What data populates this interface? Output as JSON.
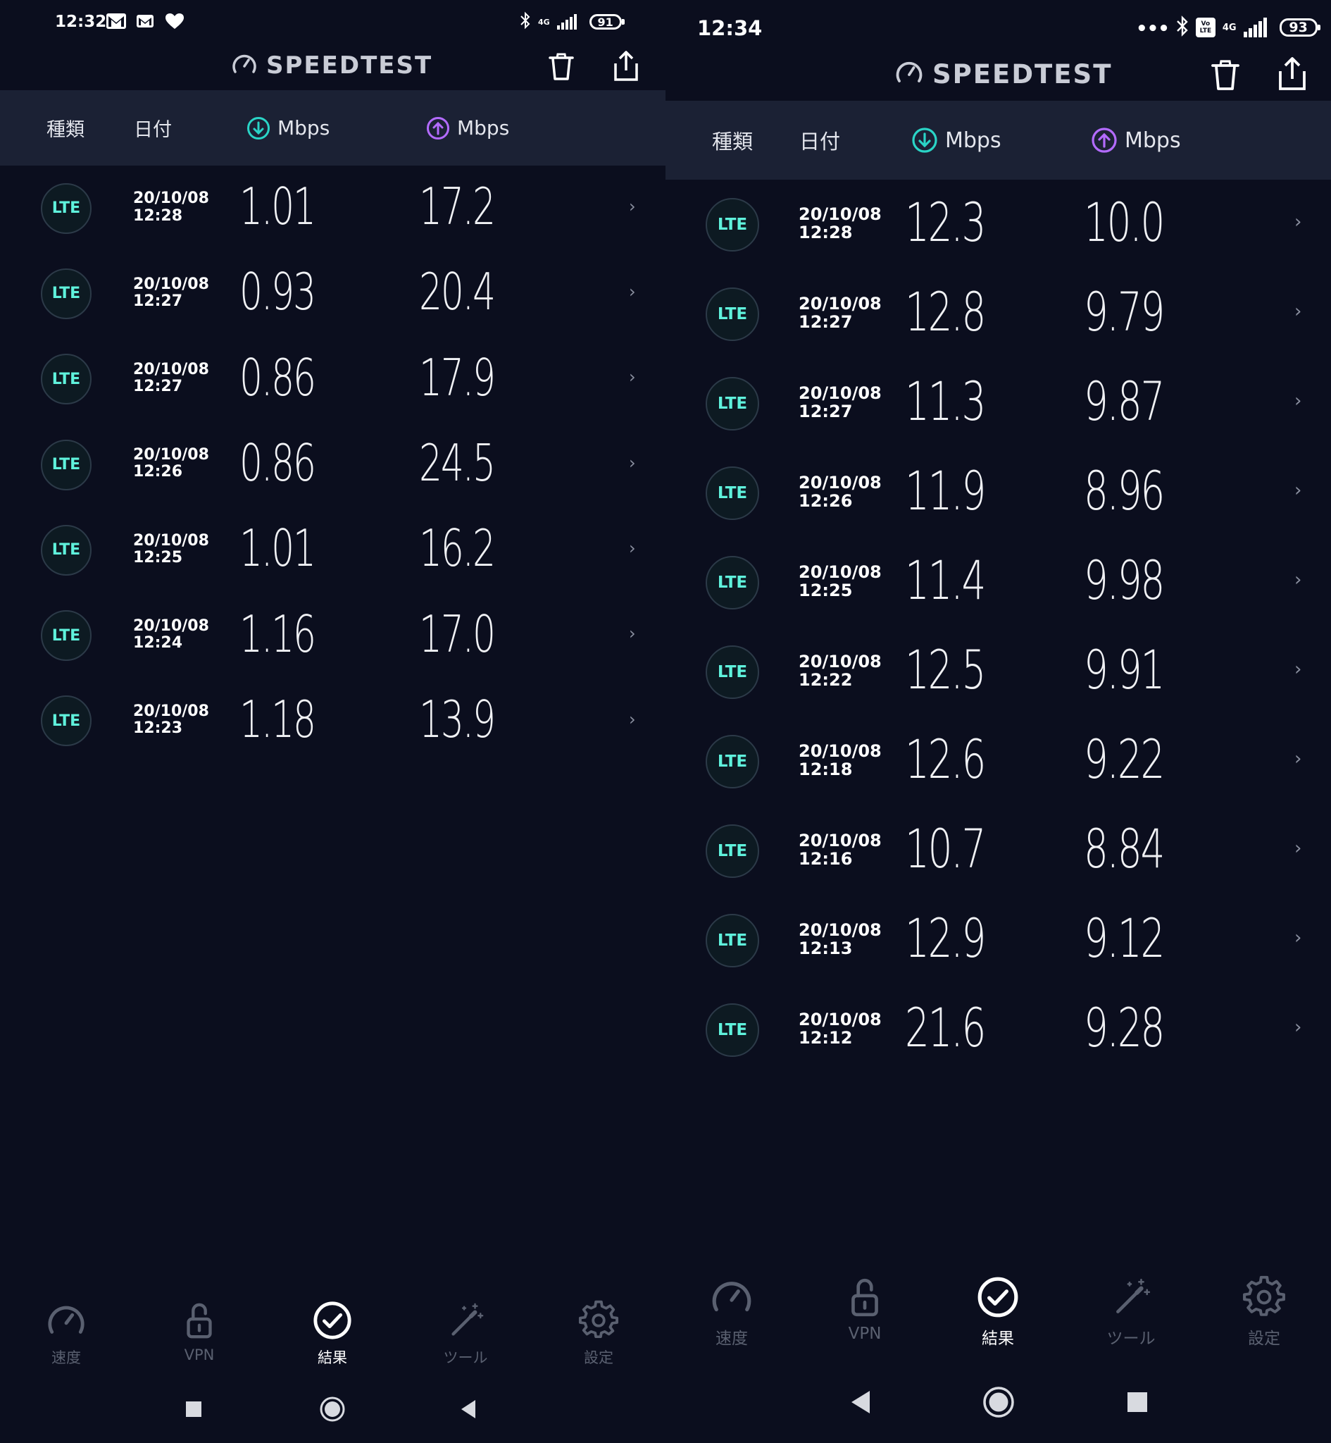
{
  "colors": {
    "background": "#0b0e1e",
    "header_band": "#1b2134",
    "lte_accent": "#5ff2dc",
    "download_accent": "#2ad4c6",
    "upload_accent": "#b36bff",
    "inactive_nav": "#5a6070"
  },
  "left": {
    "status": {
      "time": "12:32",
      "network_tag": "4G",
      "battery": "91"
    },
    "appbar": {
      "title": "SPEEDTEST",
      "icons": [
        "speedometer-icon",
        "trash-icon",
        "share-icon"
      ]
    },
    "columns": {
      "type": "種類",
      "date": "日付",
      "download": "Mbps",
      "upload": "Mbps"
    },
    "rows": [
      {
        "type": "LTE",
        "date": "20/10/08",
        "time": "12:28",
        "download": "1.01",
        "upload": "17.2"
      },
      {
        "type": "LTE",
        "date": "20/10/08",
        "time": "12:27",
        "download": "0.93",
        "upload": "20.4"
      },
      {
        "type": "LTE",
        "date": "20/10/08",
        "time": "12:27",
        "download": "0.86",
        "upload": "17.9"
      },
      {
        "type": "LTE",
        "date": "20/10/08",
        "time": "12:26",
        "download": "0.86",
        "upload": "24.5"
      },
      {
        "type": "LTE",
        "date": "20/10/08",
        "time": "12:25",
        "download": "1.01",
        "upload": "16.2"
      },
      {
        "type": "LTE",
        "date": "20/10/08",
        "time": "12:24",
        "download": "1.16",
        "upload": "17.0"
      },
      {
        "type": "LTE",
        "date": "20/10/08",
        "time": "12:23",
        "download": "1.18",
        "upload": "13.9"
      }
    ],
    "nav": [
      {
        "label": "速度",
        "icon": "speed-gauge-icon",
        "active": false
      },
      {
        "label": "VPN",
        "icon": "unlock-icon",
        "active": false
      },
      {
        "label": "結果",
        "icon": "check-circle-icon",
        "active": true
      },
      {
        "label": "ツール",
        "icon": "magic-wand-icon",
        "active": false
      },
      {
        "label": "設定",
        "icon": "gear-icon",
        "active": false
      }
    ]
  },
  "right": {
    "status": {
      "time": "12:34",
      "network_tag": "4G",
      "volte_tag": "Vo LTE",
      "battery": "93"
    },
    "appbar": {
      "title": "SPEEDTEST",
      "icons": [
        "speedometer-icon",
        "trash-icon",
        "share-icon"
      ]
    },
    "columns": {
      "type": "種類",
      "date": "日付",
      "download": "Mbps",
      "upload": "Mbps"
    },
    "rows": [
      {
        "type": "LTE",
        "date": "20/10/08",
        "time": "12:28",
        "download": "12.3",
        "upload": "10.0"
      },
      {
        "type": "LTE",
        "date": "20/10/08",
        "time": "12:27",
        "download": "12.8",
        "upload": "9.79"
      },
      {
        "type": "LTE",
        "date": "20/10/08",
        "time": "12:27",
        "download": "11.3",
        "upload": "9.87"
      },
      {
        "type": "LTE",
        "date": "20/10/08",
        "time": "12:26",
        "download": "11.9",
        "upload": "8.96"
      },
      {
        "type": "LTE",
        "date": "20/10/08",
        "time": "12:25",
        "download": "11.4",
        "upload": "9.98"
      },
      {
        "type": "LTE",
        "date": "20/10/08",
        "time": "12:22",
        "download": "12.5",
        "upload": "9.91"
      },
      {
        "type": "LTE",
        "date": "20/10/08",
        "time": "12:18",
        "download": "12.6",
        "upload": "9.22"
      },
      {
        "type": "LTE",
        "date": "20/10/08",
        "time": "12:16",
        "download": "10.7",
        "upload": "8.84"
      },
      {
        "type": "LTE",
        "date": "20/10/08",
        "time": "12:13",
        "download": "12.9",
        "upload": "9.12"
      },
      {
        "type": "LTE",
        "date": "20/10/08",
        "time": "12:12",
        "download": "21.6",
        "upload": "9.28"
      }
    ],
    "nav": [
      {
        "label": "速度",
        "icon": "speed-gauge-icon",
        "active": false
      },
      {
        "label": "VPN",
        "icon": "unlock-icon",
        "active": false
      },
      {
        "label": "結果",
        "icon": "check-circle-icon",
        "active": true
      },
      {
        "label": "ツール",
        "icon": "magic-wand-icon",
        "active": false
      },
      {
        "label": "設定",
        "icon": "gear-icon",
        "active": false
      }
    ]
  }
}
